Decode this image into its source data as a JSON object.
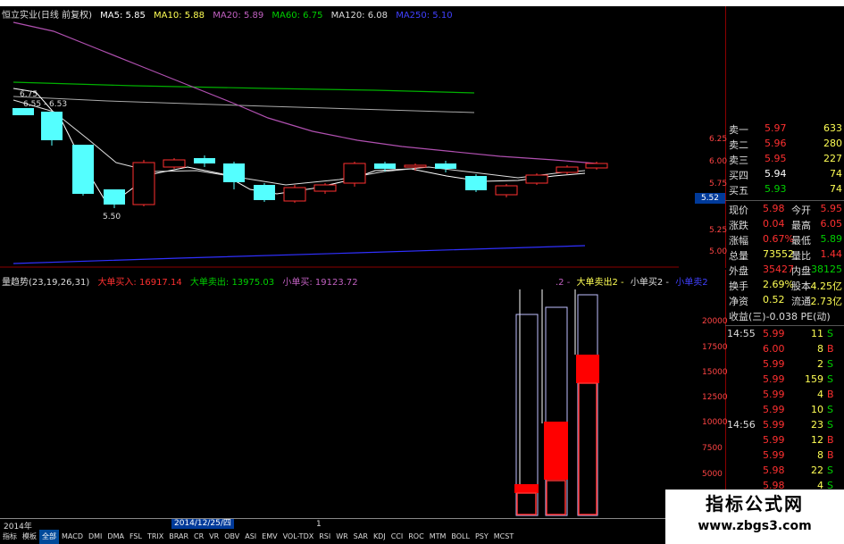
{
  "colors": {
    "red": "#ff3030",
    "cyan": "#54ffff",
    "white": "#ffffff",
    "yellow": "#ffff54",
    "green": "#00d000",
    "purple": "#c060c0",
    "blue": "#4040ff",
    "grid": "#8b0000"
  },
  "main_legend": {
    "name": "恒立实业(日线 前复权)",
    "ma5": "MA5: 5.85",
    "ma10": "MA10: 5.88",
    "ma20": "MA20: 5.89",
    "ma60": "MA60: 6.75",
    "ma120": "MA120: 6.08",
    "ma250": "MA250: 5.10"
  },
  "price_annotations": {
    "high": "6.75",
    "pivot": "6.55 - 6.53",
    "low": "5.50"
  },
  "price_axis": [
    "6.25",
    "6.00",
    "5.75",
    "5.52",
    "5.25",
    "5.00"
  ],
  "vol_legend": {
    "name": "量趋势(23,19,26,31)",
    "big_buy": "大单买入: 16917.14",
    "big_sell": "大单卖出: 13975.03",
    "small_buy": "小单买: 19123.72"
  },
  "right_legend": {
    "a": ".2 -",
    "b": "大单卖出2 -",
    "c": "小单买2 -",
    "d": "小单卖2"
  },
  "vol_axis": [
    "20000",
    "17500",
    "15000",
    "12500",
    "10000",
    "7500",
    "5000"
  ],
  "order_book": [
    {
      "label": "卖一",
      "price": "5.97",
      "vol": "633"
    },
    {
      "label": "卖二",
      "price": "5.96",
      "vol": "280"
    },
    {
      "label": "卖三",
      "price": "5.95",
      "vol": "227"
    },
    {
      "label": "买四",
      "price": "5.94",
      "vol": "74"
    },
    {
      "label": "买五",
      "price": "5.93",
      "vol": "74"
    }
  ],
  "quote": [
    {
      "l1": "现价",
      "v1": "5.98",
      "l2": "今开",
      "v2": "5.95"
    },
    {
      "l1": "涨跌",
      "v1": "0.04",
      "l2": "最高",
      "v2": "6.05"
    },
    {
      "l1": "涨幅",
      "v1": "0.67%",
      "l2": "最低",
      "v2": "5.89"
    },
    {
      "l1": "总量",
      "v1": "73552",
      "l2": "量比",
      "v2": "1.44"
    },
    {
      "l1": "外盘",
      "v1": "35427",
      "l2": "内盘",
      "v2": "38125"
    },
    {
      "l1": "换手",
      "v1": "2.69%",
      "l2": "股本",
      "v2": "4.25亿"
    },
    {
      "l1": "净资",
      "v1": "0.52",
      "l2": "流通",
      "v2": "2.73亿"
    }
  ],
  "pe_row": "收益(三)-0.038 PE(动)",
  "ticks": [
    {
      "time": "14:55",
      "price": "5.99",
      "vol": "11",
      "side": "S"
    },
    {
      "time": "",
      "price": "6.00",
      "vol": "8",
      "side": "B"
    },
    {
      "time": "",
      "price": "5.99",
      "vol": "2",
      "side": "S"
    },
    {
      "time": "",
      "price": "5.99",
      "vol": "159",
      "side": "S"
    },
    {
      "time": "",
      "price": "5.99",
      "vol": "4",
      "side": "B"
    },
    {
      "time": "",
      "price": "5.99",
      "vol": "10",
      "side": "S"
    },
    {
      "time": "14:56",
      "price": "5.99",
      "vol": "23",
      "side": "S"
    },
    {
      "time": "",
      "price": "5.99",
      "vol": "12",
      "side": "B"
    },
    {
      "time": "",
      "price": "5.99",
      "vol": "8",
      "side": "B"
    },
    {
      "time": "",
      "price": "5.98",
      "vol": "22",
      "side": "S"
    },
    {
      "time": "",
      "price": "5.98",
      "vol": "4",
      "side": "S"
    }
  ],
  "time_axis": {
    "year": "2014年",
    "date": "2014/12/25/四",
    "marker": "1"
  },
  "tabs": [
    "指标",
    "模板",
    "全部",
    "MACD",
    "DMI",
    "DMA",
    "FSL",
    "TRIX",
    "BRAR",
    "CR",
    "VR",
    "OBV",
    "ASI",
    "EMV",
    "VOL-TDX",
    "RSI",
    "WR",
    "SAR",
    "KDJ",
    "CCI",
    "ROC",
    "MTM",
    "BOLL",
    "PSY",
    "MCST"
  ],
  "active_tab": 2,
  "watermark": {
    "title": "指标公式网",
    "url": "www.zbgs3.com"
  }
}
